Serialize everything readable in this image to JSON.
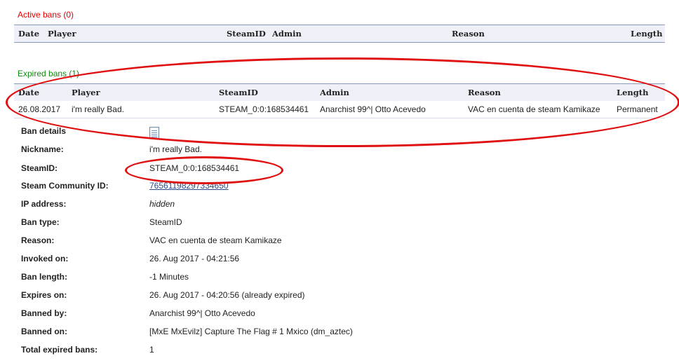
{
  "active": {
    "title": "Active bans (0)",
    "columns": {
      "date": "Date",
      "player": "Player",
      "steamid": "SteamID",
      "admin": "Admin",
      "reason": "Reason",
      "length": "Length"
    }
  },
  "expired": {
    "title": "Expired bans (1)",
    "columns": {
      "date": "Date",
      "player": "Player",
      "steamid": "SteamID",
      "admin": "Admin",
      "reason": "Reason",
      "length": "Length"
    },
    "row": {
      "date": "26.08.2017",
      "player": "i'm really Bad.",
      "steamid": "STEAM_0:0:168534461",
      "admin": "Anarchist 99^| Otto Acevedo",
      "reason": "VAC en cuenta de steam Kamikaze",
      "length": "Permanent"
    }
  },
  "details": {
    "ban_details_label": "Ban details",
    "ban_details_icon": "document-icon",
    "nickname_label": "Nickname:",
    "nickname": "i'm really Bad.",
    "steamid_label": "SteamID:",
    "steamid": "STEAM_0:0:168534461",
    "community_label": "Steam Community ID:",
    "community_id": "76561198297334650",
    "ip_label": "IP address:",
    "ip": "hidden",
    "type_label": "Ban type:",
    "type": "SteamID",
    "reason_label": "Reason:",
    "reason": "VAC en cuenta de steam Kamikaze",
    "invoked_label": "Invoked on:",
    "invoked": "26. Aug 2017 - 04:21:56",
    "length_label": "Ban length:",
    "length": "-1 Minutes",
    "expires_label": "Expires on:",
    "expires": "26. Aug 2017 - 04:20:56 (already expired)",
    "banned_by_label": "Banned by:",
    "banned_by": "Anarchist 99^| Otto Acevedo",
    "banned_on_label": "Banned on:",
    "banned_on": "[MxE MxEvilz] Capture The Flag # 1 Mxico (dm_aztec)",
    "total_label": "Total expired bans:",
    "total": "1"
  },
  "colors": {
    "active_title": "#e00000",
    "expired_title": "#108a10",
    "annotation": "#e01010",
    "header_bg": "#eef0f7"
  }
}
